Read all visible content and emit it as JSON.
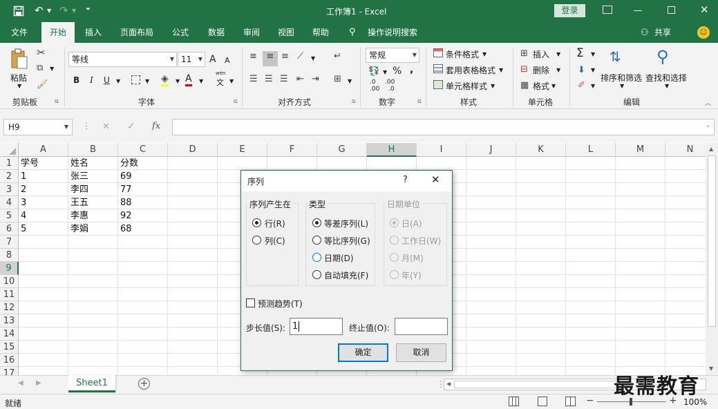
{
  "window": {
    "title": "工作簿1 - Excel",
    "login": "登录"
  },
  "tabs": [
    "文件",
    "开始",
    "插入",
    "页面布局",
    "公式",
    "数据",
    "审阅",
    "视图",
    "帮助",
    "操作说明搜索"
  ],
  "share": "共享",
  "ribbon": {
    "clipboard": {
      "paste": "粘贴",
      "label": "剪贴板"
    },
    "font": {
      "name": "等线",
      "size": "11",
      "label": "字体",
      "bold": "B",
      "italic": "I",
      "underline": "U",
      "grow": "A",
      "shrink": "A",
      "color_a": "A",
      "phonetic_top": "wén",
      "phonetic": "文"
    },
    "alignment": {
      "label": "对齐方式"
    },
    "number": {
      "format": "常规",
      "label": "数字",
      "percent": "%",
      "comma": ",",
      "inc": ".0",
      "inc_bottom": ".00",
      "dec": ".00",
      "dec_bottom": ".0"
    },
    "styles": {
      "conditional": "条件格式",
      "table": "套用表格格式",
      "cell": "单元格样式",
      "label": "样式"
    },
    "cells": {
      "insert": "插入",
      "delete": "删除",
      "format": "格式",
      "label": "单元格"
    },
    "editing": {
      "sort": "排序和筛选",
      "find": "查找和选择",
      "label": "编辑",
      "sum": "Σ"
    }
  },
  "formula_bar": {
    "name_box": "H9",
    "fx": "fx",
    "cancel": "✕",
    "enter": "✓"
  },
  "grid": {
    "columns": [
      "A",
      "B",
      "C",
      "D",
      "E",
      "F",
      "G",
      "H",
      "I",
      "J",
      "K",
      "L",
      "M",
      "N"
    ],
    "rows": [
      "1",
      "2",
      "3",
      "4",
      "5",
      "6",
      "7",
      "8",
      "9",
      "10",
      "11",
      "12",
      "13",
      "14",
      "15",
      "16",
      "17"
    ],
    "cells": [
      [
        "学号",
        "姓名",
        "分数"
      ],
      [
        "1",
        "张三",
        "69"
      ],
      [
        "2",
        "李四",
        "77"
      ],
      [
        "3",
        "王五",
        "88"
      ],
      [
        "4",
        "李惠",
        "92"
      ],
      [
        "5",
        "李娟",
        "68"
      ]
    ]
  },
  "sheet": {
    "name": "Sheet1"
  },
  "status": {
    "ready": "就绪",
    "zoom": "100%",
    "minus": "−",
    "plus": "+"
  },
  "dialog": {
    "title": "序列",
    "help": "?",
    "group_series_in": "序列产生在",
    "row": "行(R)",
    "col": "列(C)",
    "group_type": "类型",
    "linear": "等差序列(L)",
    "growth": "等比序列(G)",
    "date": "日期(D)",
    "autofill": "自动填充(F)",
    "group_date_unit": "日期单位",
    "day": "日(A)",
    "weekday": "工作日(W)",
    "month": "月(M)",
    "year": "年(Y)",
    "trend": "预测趋势(T)",
    "step_label": "步长值(S):",
    "step_value": "1",
    "stop_label": "终止值(O):",
    "stop_value": "",
    "ok": "确定",
    "cancel": "取消"
  },
  "watermark": "最需教育",
  "colors": {
    "accent": "#217346",
    "focus": "#0078d7"
  }
}
